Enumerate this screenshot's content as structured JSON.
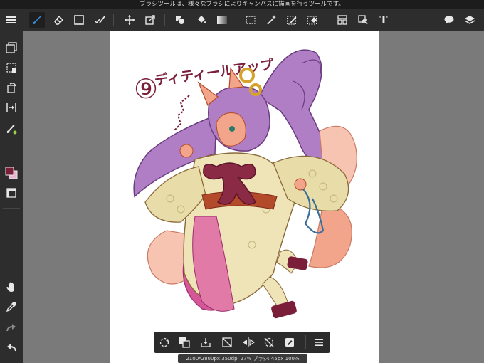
{
  "tooltip": {
    "text": "ブラシツールは、様々なブラシによりキャンバスに描画を行うツールです。"
  },
  "toolbar": {
    "tools": [
      {
        "name": "menu-icon",
        "active": false
      },
      {
        "name": "brush-icon",
        "active": true
      },
      {
        "name": "eraser-icon",
        "active": false
      },
      {
        "name": "shape-icon",
        "active": false
      },
      {
        "name": "correction-icon",
        "active": false
      },
      {
        "name": "move-icon",
        "active": false
      },
      {
        "name": "transform-icon",
        "active": false
      },
      {
        "name": "fill-icon",
        "active": false
      },
      {
        "name": "bucket-icon",
        "active": false
      },
      {
        "name": "gradient-icon",
        "active": false
      },
      {
        "name": "select-icon",
        "active": false
      },
      {
        "name": "magic-wand-icon",
        "active": false
      },
      {
        "name": "select-pen-icon",
        "active": false
      },
      {
        "name": "select-eraser-icon",
        "active": false
      },
      {
        "name": "frame-divider-icon",
        "active": false
      },
      {
        "name": "operation-icon",
        "active": false
      },
      {
        "name": "text-icon",
        "active": false
      },
      {
        "name": "speech-bubble-icon",
        "active": false
      },
      {
        "name": "layers-icon",
        "active": false
      }
    ],
    "text_tool_label": "T",
    "accent_color": "#3a8ddb"
  },
  "sidebar": {
    "items": [
      "layer-copy-icon",
      "selection-icon",
      "rotate-icon",
      "snap-icon",
      "brush-settings-icon",
      "color-swatch-icon",
      "reference-window-icon",
      "hand-icon",
      "eyedropper-icon",
      "redo-icon",
      "undo-icon"
    ],
    "foreground_color": "#7a1e3a",
    "background_color": "#e8b4cc"
  },
  "bottombar": {
    "items": [
      "rotate-canvas-icon",
      "swap-layers-icon",
      "import-icon",
      "clear-icon",
      "flip-icon",
      "no-rotate-icon",
      "edit-icon",
      "more-menu-icon"
    ]
  },
  "status": {
    "text": "2100*2800px 350dpi 27% ブラシ: 45px 100%"
  },
  "artwork": {
    "title_mark": "⑨",
    "title_text": "ディティールアップ",
    "title_color": "#7a1e3a",
    "hair_color": "#b07ec4",
    "fur_color": "#f2a58a",
    "robe_color": "#efe4b8",
    "accent_colors": [
      "#8a2a44",
      "#d6569a",
      "#b34a2a",
      "#3b6f9a"
    ]
  }
}
